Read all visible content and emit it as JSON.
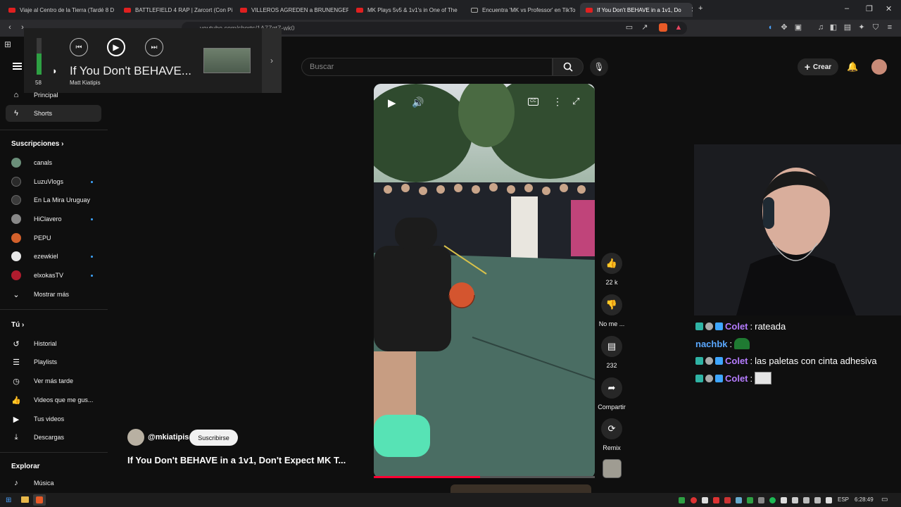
{
  "tabs": [
    {
      "label": "Viaje al Centro de la Tierra (Tardé 8 D",
      "favicon": "youtube-icon"
    },
    {
      "label": "BATTLEFIELD 4 RAP | Zarcort (Con Pi",
      "favicon": "youtube-icon"
    },
    {
      "label": "VILLEROS AGREDEN a BRUNENGER y",
      "favicon": "youtube-icon"
    },
    {
      "label": "MK Plays 5v5 & 1v1's in One of The",
      "favicon": "youtube-icon"
    },
    {
      "label": "Encuentra 'MK vs Professor' en TikTo",
      "favicon": "tiktok-icon"
    },
    {
      "label": "If You Don't BEHAVE in a 1v1, Do",
      "favicon": "youtube-icon"
    }
  ],
  "address_bar": {
    "url": "youtube.com/shorts/1A7ZqtZ-wk0"
  },
  "media_overlay": {
    "volume_level": 58,
    "volume_value": "58",
    "title": "If You Don't BEHAVE...",
    "artist": "Matt Kiatipis"
  },
  "search": {
    "placeholder": "Buscar"
  },
  "header": {
    "create_label": "Crear"
  },
  "sidebar": {
    "main": [
      {
        "label": "Principal"
      },
      {
        "label": "Shorts"
      }
    ],
    "subscriptions_title": "Suscripciones",
    "subscriptions": [
      {
        "label": "canals",
        "new": false,
        "avatar_color": "#6b8f7a"
      },
      {
        "label": "LuzuVlogs",
        "new": true,
        "avatar_color": "#2a2a2a"
      },
      {
        "label": "En La Mira Uruguay",
        "new": false,
        "avatar_color": "#3b3b3b"
      },
      {
        "label": "HiClavero",
        "new": true,
        "avatar_color": "#888888"
      },
      {
        "label": "PEPU",
        "new": false,
        "avatar_color": "#d2602b"
      },
      {
        "label": "ezewkiel",
        "new": true,
        "avatar_color": "#e8e8e8"
      },
      {
        "label": "elxokasTV",
        "new": true,
        "avatar_color": "#b01c2e"
      }
    ],
    "show_more": "Mostrar más",
    "you_title": "Tú",
    "you_items": [
      {
        "label": "Historial",
        "icon": "history-icon"
      },
      {
        "label": "Playlists",
        "icon": "playlist-icon"
      },
      {
        "label": "Ver más tarde",
        "icon": "clock-icon"
      },
      {
        "label": "Videos que me gus...",
        "icon": "thumbs-up-icon"
      },
      {
        "label": "Tus videos",
        "icon": "video-icon"
      },
      {
        "label": "Descargas",
        "icon": "download-icon"
      }
    ],
    "explore_title": "Explorar",
    "explore_items": [
      {
        "label": "Música",
        "icon": "music-icon"
      }
    ]
  },
  "short": {
    "channel": "@mkiatipis",
    "subscribe_label": "Suscribirse",
    "title": "If You Don't BEHAVE in a 1v1, Don't Expect MK T...",
    "progress": 0.48,
    "actions": {
      "like": "22 k",
      "dislike": "No me ...",
      "comments": "232",
      "share": "Compartir",
      "remix": "Remix"
    }
  },
  "chat": [
    {
      "user": "Colet",
      "message": "rateada",
      "user_color": "#b57cff"
    },
    {
      "user": "nachbk",
      "message": "",
      "user_color": "#5aa8ff",
      "emote": "green-emote"
    },
    {
      "user": "Colet",
      "message": "las paletas con cinta adhesiva",
      "user_color": "#b57cff"
    },
    {
      "user": "Colet",
      "message": "",
      "user_color": "#b57cff",
      "emote": "image-emote"
    }
  ],
  "taskbar": {
    "language": "ESP",
    "time": "6:28:49"
  },
  "colors": {
    "accent_red": "#ff0033",
    "background": "#0f0f0f",
    "link_blue": "#3ea6ff"
  }
}
